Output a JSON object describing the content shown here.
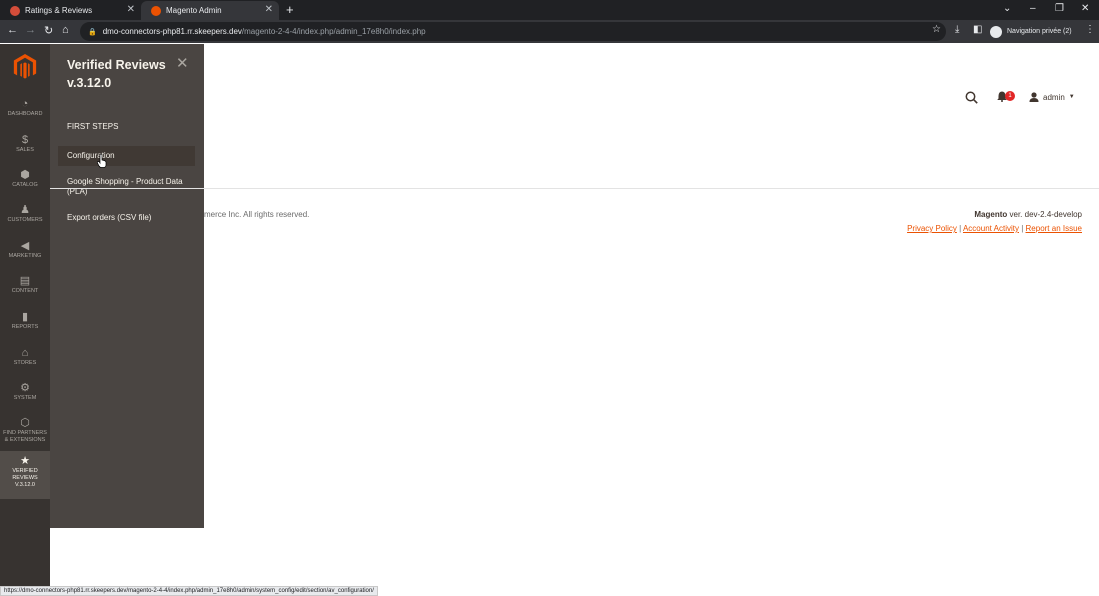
{
  "browser": {
    "tabs": [
      {
        "label": "Ratings & Reviews",
        "favicon_color": "#d44d3a"
      },
      {
        "label": "Magento Admin",
        "favicon_color": "#eb5202"
      }
    ],
    "url_host": "dmo-connectors-php81.rr.skeepers.dev",
    "url_path": "/magento-2-4-4/index.php/admin_17e8h0/index.php",
    "profile_label": "Navigation privée (2)",
    "status_url": "https://dmo-connectors-php81.rr.skeepers.dev/magento-2-4-4/index.php/admin_17e8h0/admin/system_config/edit/section/av_configuration/"
  },
  "sidebar": {
    "items": [
      {
        "label": "DASHBOARD",
        "icon": "dashboard-icon",
        "glyph": "◔"
      },
      {
        "label": "SALES",
        "icon": "dollar-icon",
        "glyph": "$"
      },
      {
        "label": "CATALOG",
        "icon": "box-icon",
        "glyph": "⬢"
      },
      {
        "label": "CUSTOMERS",
        "icon": "person-icon",
        "glyph": "♟"
      },
      {
        "label": "MARKETING",
        "icon": "megaphone-icon",
        "glyph": "📢"
      },
      {
        "label": "CONTENT",
        "icon": "layout-icon",
        "glyph": "▤"
      },
      {
        "label": "REPORTS",
        "icon": "bar-chart-icon",
        "glyph": "▮"
      },
      {
        "label": "STORES",
        "icon": "store-icon",
        "glyph": "⌂"
      },
      {
        "label": "SYSTEM",
        "icon": "gear-icon",
        "glyph": "⚙"
      },
      {
        "label_line1": "FIND PARTNERS",
        "label_line2": "& EXTENSIONS",
        "icon": "cube-icon",
        "glyph": "⬡"
      },
      {
        "label_line1": "VERIFIED",
        "label_line2": "REVIEWS",
        "label_line3": "V.3.12.0",
        "icon": "star-icon",
        "glyph": "★"
      }
    ]
  },
  "flyout": {
    "title_line1": "Verified Reviews",
    "title_line2": "v.3.12.0",
    "section": "FIRST STEPS",
    "links": [
      "Configuration",
      "Google Shopping - Product Data (PLA)",
      "Export orders (CSV file)"
    ]
  },
  "header": {
    "notification_count": "1",
    "user": "admin"
  },
  "footer": {
    "copyright": "merce Inc. All rights reserved.",
    "brand": "Magento",
    "version": " ver. dev-2.4-develop",
    "links": [
      "Privacy Policy",
      "Account Activity",
      "Report an Issue"
    ],
    "separator": " | "
  },
  "colors": {
    "accent": "#eb5202",
    "sidebar_bg": "#373330",
    "flyout_bg": "#4a4542"
  }
}
